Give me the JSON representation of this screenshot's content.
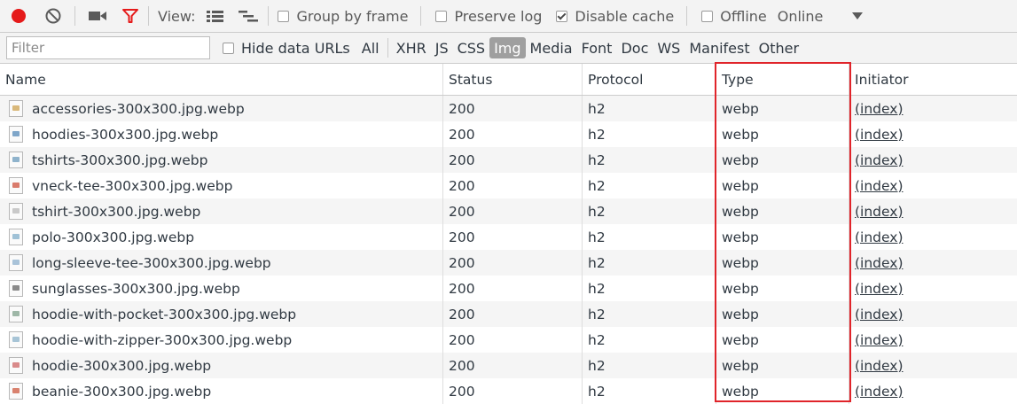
{
  "toolbar": {
    "view_label": "View:",
    "group_by_frame": "Group by frame",
    "preserve_log": "Preserve log",
    "disable_cache": "Disable cache",
    "offline": "Offline",
    "throttle_value": "Online",
    "colors": {
      "record": "#e51a1a",
      "filter_icon": "#e51a1a"
    }
  },
  "filterbar": {
    "placeholder": "Filter",
    "hide_data_urls": "Hide data URLs",
    "types": [
      "All",
      "XHR",
      "JS",
      "CSS",
      "Img",
      "Media",
      "Font",
      "Doc",
      "WS",
      "Manifest",
      "Other"
    ],
    "active_type": "Img"
  },
  "table": {
    "headers": {
      "name": "Name",
      "status": "Status",
      "protocol": "Protocol",
      "type": "Type",
      "initiator": "Initiator"
    },
    "rows": [
      {
        "name": "accessories-300x300.jpg.webp",
        "status": "200",
        "protocol": "h2",
        "type": "webp",
        "initiator": "(index)"
      },
      {
        "name": "hoodies-300x300.jpg.webp",
        "status": "200",
        "protocol": "h2",
        "type": "webp",
        "initiator": "(index)"
      },
      {
        "name": "tshirts-300x300.jpg.webp",
        "status": "200",
        "protocol": "h2",
        "type": "webp",
        "initiator": "(index)"
      },
      {
        "name": "vneck-tee-300x300.jpg.webp",
        "status": "200",
        "protocol": "h2",
        "type": "webp",
        "initiator": "(index)"
      },
      {
        "name": "tshirt-300x300.jpg.webp",
        "status": "200",
        "protocol": "h2",
        "type": "webp",
        "initiator": "(index)"
      },
      {
        "name": "polo-300x300.jpg.webp",
        "status": "200",
        "protocol": "h2",
        "type": "webp",
        "initiator": "(index)"
      },
      {
        "name": "long-sleeve-tee-300x300.jpg.webp",
        "status": "200",
        "protocol": "h2",
        "type": "webp",
        "initiator": "(index)"
      },
      {
        "name": "sunglasses-300x300.jpg.webp",
        "status": "200",
        "protocol": "h2",
        "type": "webp",
        "initiator": "(index)"
      },
      {
        "name": "hoodie-with-pocket-300x300.jpg.webp",
        "status": "200",
        "protocol": "h2",
        "type": "webp",
        "initiator": "(index)"
      },
      {
        "name": "hoodie-with-zipper-300x300.jpg.webp",
        "status": "200",
        "protocol": "h2",
        "type": "webp",
        "initiator": "(index)"
      },
      {
        "name": "hoodie-300x300.jpg.webp",
        "status": "200",
        "protocol": "h2",
        "type": "webp",
        "initiator": "(index)"
      },
      {
        "name": "beanie-300x300.jpg.webp",
        "status": "200",
        "protocol": "h2",
        "type": "webp",
        "initiator": "(index)"
      }
    ],
    "highlight_color": "#e0242a"
  }
}
